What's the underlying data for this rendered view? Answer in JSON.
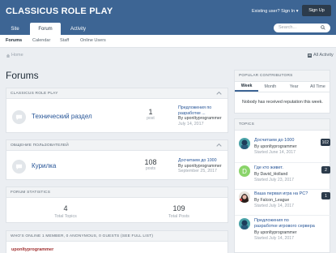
{
  "header": {
    "brand": "CLASSICUS ROLE PLAY",
    "existing_user": "Existing user? Sign In ▾",
    "signup": "Sign Up",
    "search_placeholder": "Search...",
    "tabs": [
      "Site",
      "Forum",
      "Activity"
    ]
  },
  "subnav": [
    "Forums",
    "Calendar",
    "Staff",
    "Online Users"
  ],
  "breadcrumb": {
    "home": "Home",
    "all_activity": "All Activity"
  },
  "page_title": "Forums",
  "categories": [
    {
      "title": "CLASSICUS ROLE PLAY",
      "forum": "Технический раздел",
      "count": "1",
      "count_label": "post",
      "last_title_1": "Предложения по",
      "last_title_2": "разработке ...",
      "last_by": "By uponltyprogrammer",
      "last_date": "July 14, 2017"
    },
    {
      "title": "ОБЩЕНИЕ ПОЛЬЗОВАТЕЛЕЙ",
      "forum": "Курилка",
      "count": "108",
      "count_label": "posts",
      "last_title_1": "Досчитаем до 1000",
      "last_title_2": "",
      "last_by": "By uponltyprogrammer",
      "last_date": "September 25, 2017"
    }
  ],
  "stats": {
    "title": "FORUM STATISTICS",
    "topics_value": "4",
    "topics_label": "Total Topics",
    "posts_value": "109",
    "posts_label": "Total Posts"
  },
  "online": {
    "title": "WHO'S ONLINE   1 MEMBER, 0 ANONYMOUS, 0 GUESTS (SEE FULL LIST)",
    "user": "uponltyprogrammer"
  },
  "contributors": {
    "title": "POPULAR CONTRIBUTORS",
    "tabs": [
      "Week",
      "Month",
      "Year",
      "All Time"
    ],
    "empty": "Nobody has received reputation this week."
  },
  "topics": {
    "title": "TOPICS",
    "items": [
      {
        "title": "Досчитаем до 1000",
        "title2": "",
        "by": "By uponltyprogrammer",
        "date": "Started June 14, 2017",
        "count": "102"
      },
      {
        "title": "Где кто живет.",
        "title2": "",
        "by": "By David_Holland",
        "date": "Started July 23, 2017",
        "count": "2"
      },
      {
        "title": "Ваша первая игра на PC?",
        "title2": "",
        "by": "By Falcon_League",
        "date": "Started July 14, 2017",
        "count": "1"
      },
      {
        "title": "Предложения по",
        "title2": "разработке игрового сервера",
        "by": "By uponltyprogrammer",
        "date": "Started July 14, 2017",
        "count": ""
      }
    ]
  },
  "colors": {
    "header": "#3d6594",
    "link": "#275597",
    "dark": "#2c3b4b"
  }
}
